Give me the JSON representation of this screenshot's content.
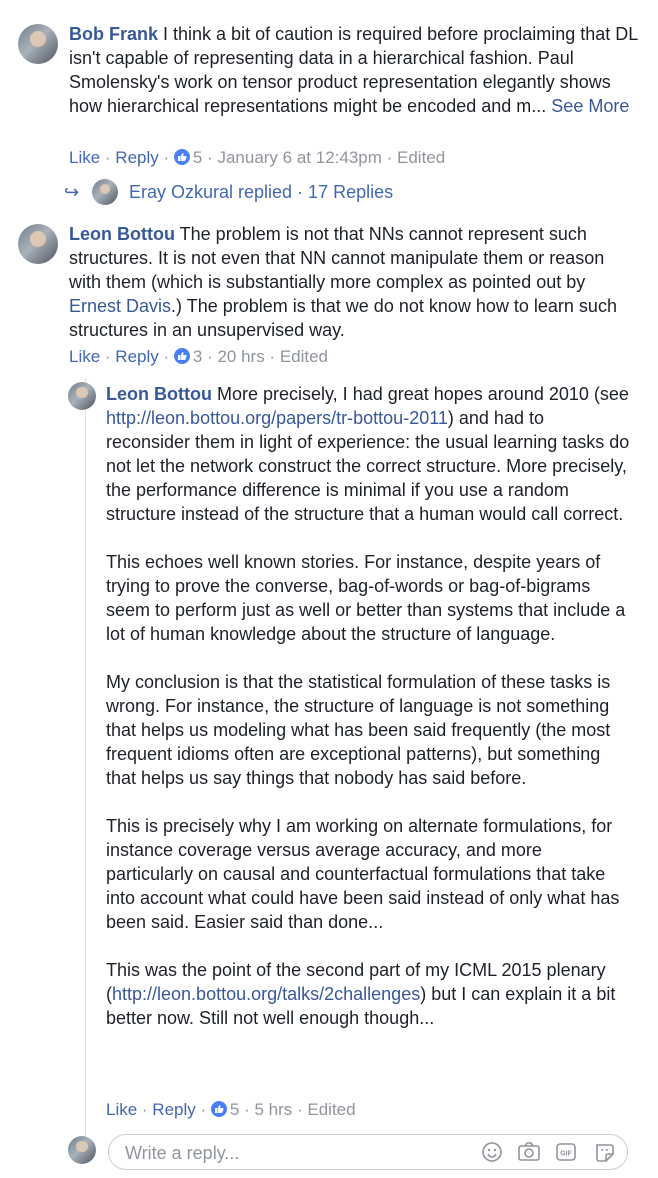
{
  "comments": [
    {
      "author": "Bob Frank",
      "text": " I think a bit of caution is required before proclaiming that DL isn't capable of representing data in a hierarchical fashion. Paul Smolensky's work on tensor product representation elegantly shows how hierarchical representations might be encoded and m...",
      "see_more": "See More",
      "like": "Like",
      "reply": "Reply",
      "reaction_count": "5",
      "time": "January 6 at 12:43pm",
      "edited": "Edited",
      "replies_author": "Eray Ozkural",
      "replies_summary": "Eray Ozkural replied · 17 Replies"
    },
    {
      "author": "Leon Bottou",
      "text_before_link": " The problem is not that NNs cannot represent such structures. It is not even that NN cannot manipulate them or reason with them (which is substantially more complex as pointed out by ",
      "link": "Ernest Davis",
      "text_after_link": ".) The problem is that we do not know how to learn such structures in an unsupervised way.",
      "like": "Like",
      "reply": "Reply",
      "reaction_count": "3",
      "time": "20 hrs",
      "edited": "Edited"
    }
  ],
  "reply": {
    "author": "Leon Bottou",
    "p1_before": " More precisely, I had great hopes around 2010 (see ",
    "p1_link": "http://leon.bottou.org/papers/tr-bottou-2011",
    "p1_after": ") and had to reconsider them in light of experience: the usual learning tasks do not let the network construct the correct structure. More precisely, the performance difference is minimal if you use a random structure instead of the structure that a human would call correct.",
    "p2": "This echoes well known stories. For instance, despite years of trying to prove the converse, bag-of-words or bag-of-bigrams seem to perform just as well or better than systems that include a lot of human knowledge about the structure of language.",
    "p3": "My conclusion is that the statistical formulation of these tasks is wrong. For instance, the structure of language is not something that helps us modeling what has been said frequently (the most frequent idioms often are exceptional patterns), but something that helps us say things that nobody has said before.",
    "p4": "This is precisely why I am working on alternate formulations, for instance coverage versus average accuracy, and more particularly on causal and counterfactual formulations that take into account what could have been said instead of only what has been said. Easier said than done...",
    "p5_before": "This was the point of the second part of my ICML 2015 plenary (",
    "p5_link": "http://leon.bottou.org/talks/2challenges",
    "p5_after": ") but I can explain it a bit better now. Still not well enough though...",
    "like": "Like",
    "reply": "Reply",
    "reaction_count": "5",
    "time": "5 hrs",
    "edited": "Edited"
  },
  "composer": {
    "placeholder": "Write a reply...",
    "icons": [
      "emoji-icon",
      "camera-icon",
      "gif-icon",
      "sticker-icon"
    ]
  },
  "colors": {
    "link": "#385898",
    "action": "#4267b2",
    "meta": "#90949c",
    "like_badge": "#4a80f5"
  }
}
